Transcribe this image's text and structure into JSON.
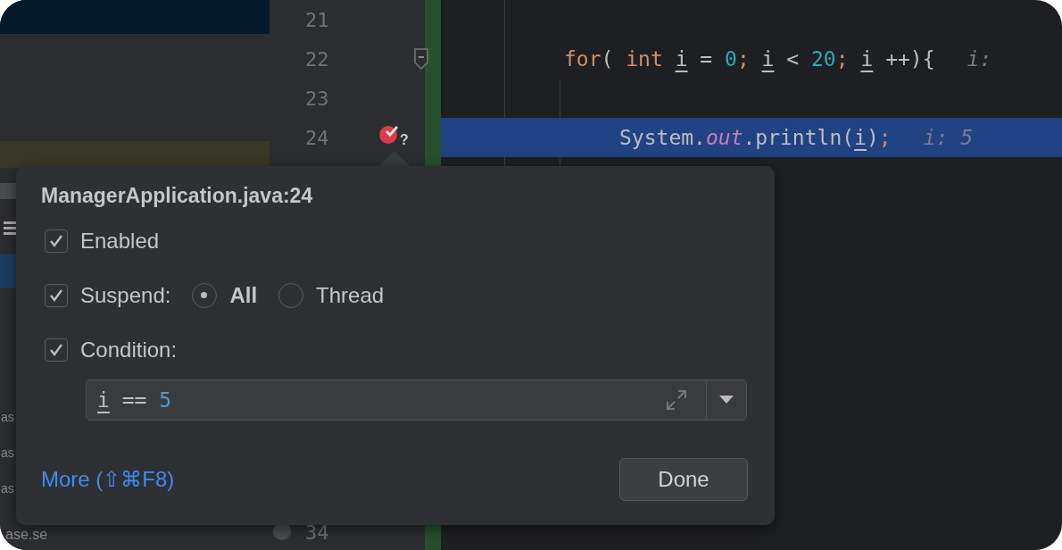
{
  "side_panel": {
    "fragments": [
      "as",
      "as",
      "as",
      "ase.se"
    ]
  },
  "editor": {
    "lines": [
      {
        "number": "21",
        "current": false,
        "breakpoint": false,
        "fold": false
      },
      {
        "number": "22",
        "current": false,
        "breakpoint": false,
        "fold": true,
        "tokens": [
          {
            "text": "for",
            "kind": "keyword"
          },
          {
            "text": "( ",
            "kind": "plain"
          },
          {
            "text": "int ",
            "kind": "keyword"
          },
          {
            "text": "i",
            "kind": "var"
          },
          {
            "text": " = ",
            "kind": "plain"
          },
          {
            "text": "0",
            "kind": "number"
          },
          {
            "text": "; ",
            "kind": "semicolon"
          },
          {
            "text": "i",
            "kind": "var"
          },
          {
            "text": " < ",
            "kind": "plain"
          },
          {
            "text": "20",
            "kind": "number"
          },
          {
            "text": "; ",
            "kind": "semicolon"
          },
          {
            "text": "i",
            "kind": "var"
          },
          {
            "text": " ++){",
            "kind": "plain"
          },
          {
            "text": "i:",
            "kind": "hint"
          }
        ]
      },
      {
        "number": "23",
        "current": false,
        "breakpoint": false,
        "fold": false
      },
      {
        "number": "24",
        "current": true,
        "breakpoint": true,
        "fold": false,
        "tokens": [
          {
            "text": "System.",
            "kind": "plain"
          },
          {
            "text": "out",
            "kind": "field"
          },
          {
            "text": ".println(",
            "kind": "plain"
          },
          {
            "text": "i",
            "kind": "var"
          },
          {
            "text": ")",
            "kind": "plain"
          },
          {
            "text": ";",
            "kind": "semicolon"
          },
          {
            "text": "i: 5",
            "kind": "hint"
          }
        ]
      }
    ],
    "bottom_line": "34",
    "breakpoint_badge": "?"
  },
  "popup": {
    "title": "ManagerApplication.java:24",
    "enabled": {
      "label": "Enabled",
      "checked": true
    },
    "suspend": {
      "label": "Suspend:",
      "checked": true,
      "options": [
        {
          "label": "All",
          "selected": true
        },
        {
          "label": "Thread",
          "selected": false
        }
      ]
    },
    "condition": {
      "label": "Condition:",
      "checked": true,
      "tokens": [
        {
          "text": "i",
          "kind": "var"
        },
        {
          "text": " == ",
          "kind": "plain"
        },
        {
          "text": "5",
          "kind": "number"
        }
      ]
    },
    "more_link": "More (⇧⌘F8)",
    "done_button": "Done"
  }
}
